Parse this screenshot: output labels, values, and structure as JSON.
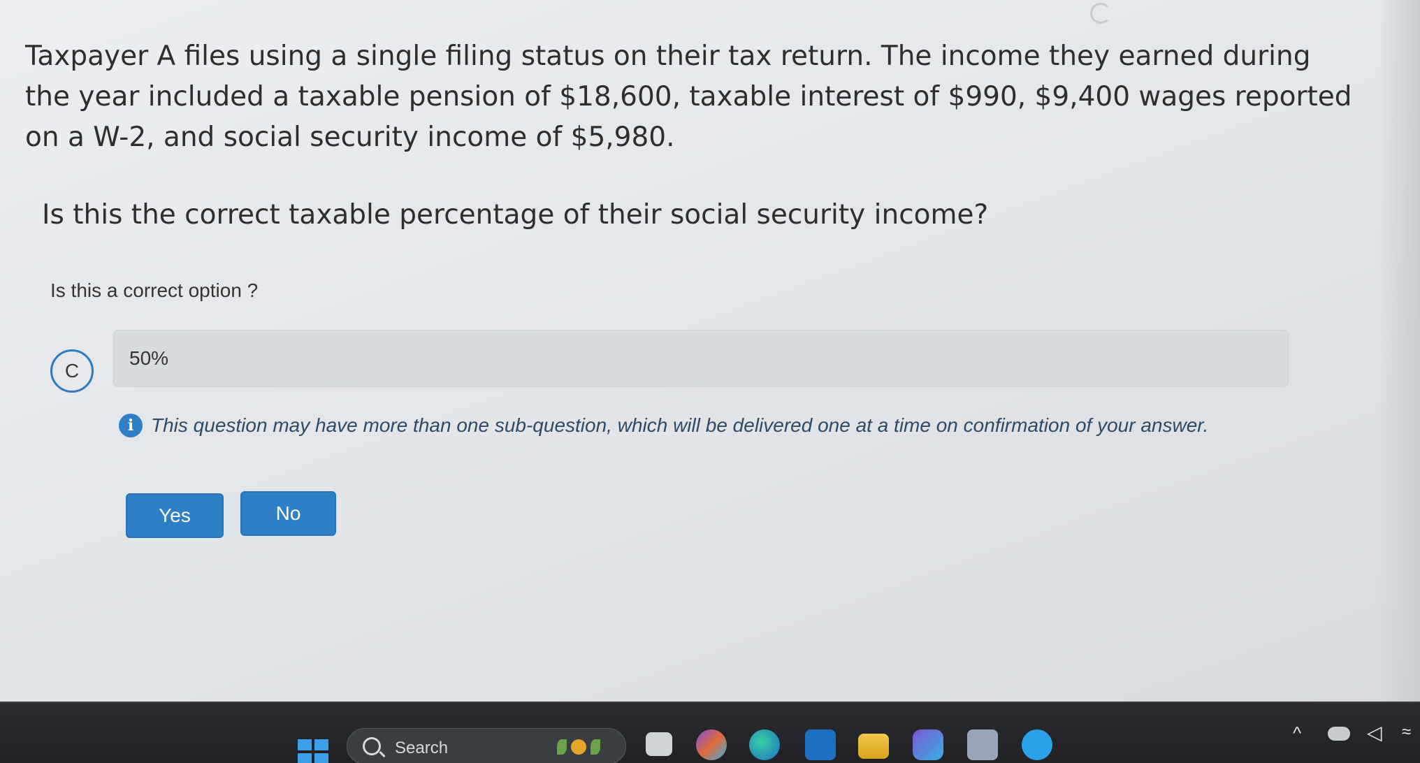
{
  "question": {
    "text": "Taxpayer A files using a single filing status on their tax return. The income they earned during the year included a taxable pension of $18,600, taxable interest of $990, $9,400 wages reported on a W-2, and social security income of $5,980."
  },
  "prompt": "Is this the correct taxable percentage of their social security income?",
  "option_label": "Is this a correct option ?",
  "option": {
    "letter": "C",
    "value": "50%"
  },
  "info": {
    "icon": "info-icon",
    "text": "This question may have more than one sub-question, which will be delivered one at a time on confirmation of your answer."
  },
  "buttons": {
    "yes": "Yes",
    "no": "No"
  },
  "taskbar": {
    "search_label": "Search",
    "icons": [
      "windows-start-icon",
      "search-icon",
      "task-view-icon",
      "copilot-icon",
      "edge-icon",
      "outlook-icon",
      "file-explorer-icon",
      "app-icon",
      "store-icon",
      "chat-icon"
    ],
    "tray_chevron": "^"
  },
  "colors": {
    "accent": "#2e80c6",
    "info_text": "#2f4a66",
    "background": "#e4e7ea"
  }
}
